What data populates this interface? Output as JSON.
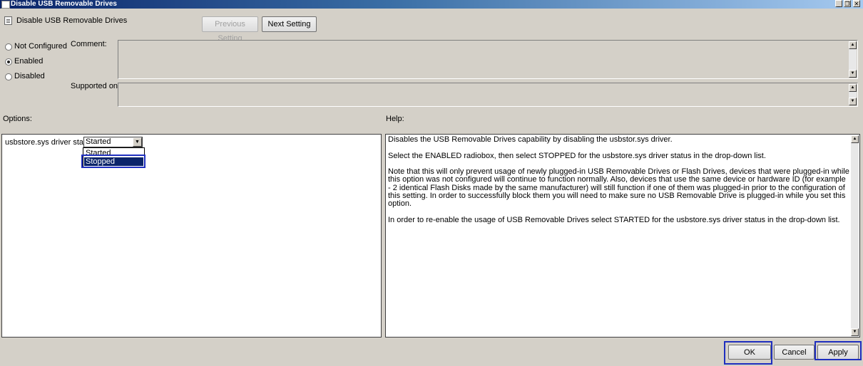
{
  "window": {
    "title": "Disable USB Removable Drives",
    "caption_buttons": [
      "_",
      "❐",
      "✕"
    ]
  },
  "header": {
    "policy_name": "Disable USB Removable Drives",
    "previous_setting": "Previous Setting",
    "next_setting": "Next Setting"
  },
  "state": {
    "not_configured": "Not Configured",
    "enabled": "Enabled",
    "disabled": "Disabled",
    "selected": "Enabled"
  },
  "labels": {
    "comment": "Comment:",
    "supported_on": "Supported on:",
    "options": "Options:",
    "help": "Help:"
  },
  "options": {
    "driver_status_label": "usbstore.sys driver status",
    "driver_status_value": "Started",
    "dropdown_options": [
      "Started",
      "Stopped"
    ],
    "dropdown_highlighted": "Stopped"
  },
  "help": {
    "paragraphs": [
      "Disables the USB Removable Drives capability by disabling the usbstor.sys driver.",
      "Select the ENABLED radiobox, then select STOPPED for the usbstore.sys driver status in the drop-down list.",
      "Note that this will only prevent usage of newly plugged-in USB Removable Drives or Flash Drives, devices that were plugged-in while this option was not configured will continue to function normally. Also, devices that use the same device or hardware ID (for example - 2 identical Flash Disks made by the same manufacturer) will still function if one of them was plugged-in prior to the configuration of this setting. In order to successfully block them you will need to make sure no USB Removable Drive is plugged-in while you set this option.",
      "In order to re-enable the usage of USB Removable Drives select STARTED for the usbstore.sys driver status in the drop-down list."
    ]
  },
  "footer": {
    "ok": "OK",
    "cancel": "Cancel",
    "apply": "Apply"
  },
  "colors": {
    "highlight_frame": "#1f2fbf",
    "title_bar": "#0a246a",
    "selection": "#0a246a"
  }
}
